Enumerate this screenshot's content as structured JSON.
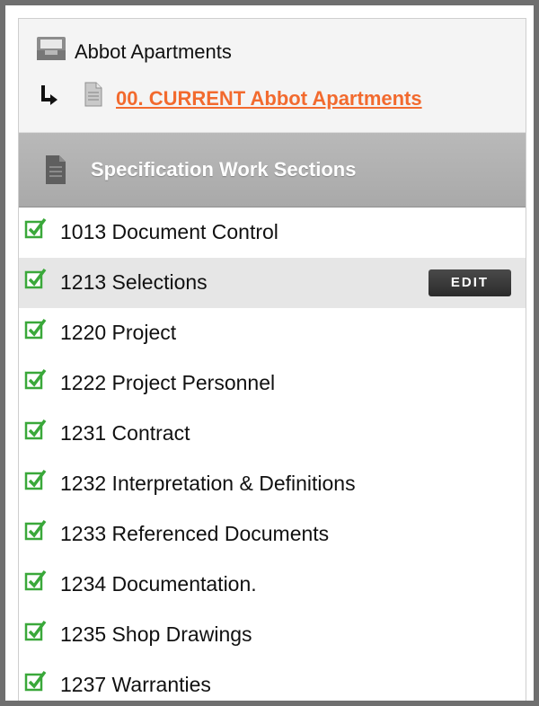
{
  "project": {
    "title": "Abbot Apartments",
    "current_link": "00. CURRENT Abbot Apartments"
  },
  "section_header": {
    "title": "Specification Work Sections"
  },
  "sections": [
    {
      "label": "1013 Document Control",
      "checked": true
    },
    {
      "label": "1213 Selections",
      "checked": true,
      "highlighted": true,
      "action": "EDIT"
    },
    {
      "label": "1220 Project",
      "checked": true
    },
    {
      "label": "1222 Project Personnel",
      "checked": true
    },
    {
      "label": "1231 Contract",
      "checked": true
    },
    {
      "label": "1232 Interpretation & Definitions",
      "checked": true
    },
    {
      "label": "1233 Referenced Documents",
      "checked": true
    },
    {
      "label": "1234 Documentation.",
      "checked": true
    },
    {
      "label": "1235 Shop Drawings",
      "checked": true
    },
    {
      "label": "1237 Warranties",
      "checked": true
    }
  ],
  "icons": {
    "project": "inbox-icon",
    "child_arrow": "arrow-icon",
    "document": "document-icon",
    "check": "checkbox-checked-icon"
  },
  "colors": {
    "link": "#f26a2e",
    "check": "#3aa83a",
    "header_bg": "#b0b0b0",
    "highlight_row": "#e6e6e6",
    "edit_button": "#333333"
  }
}
